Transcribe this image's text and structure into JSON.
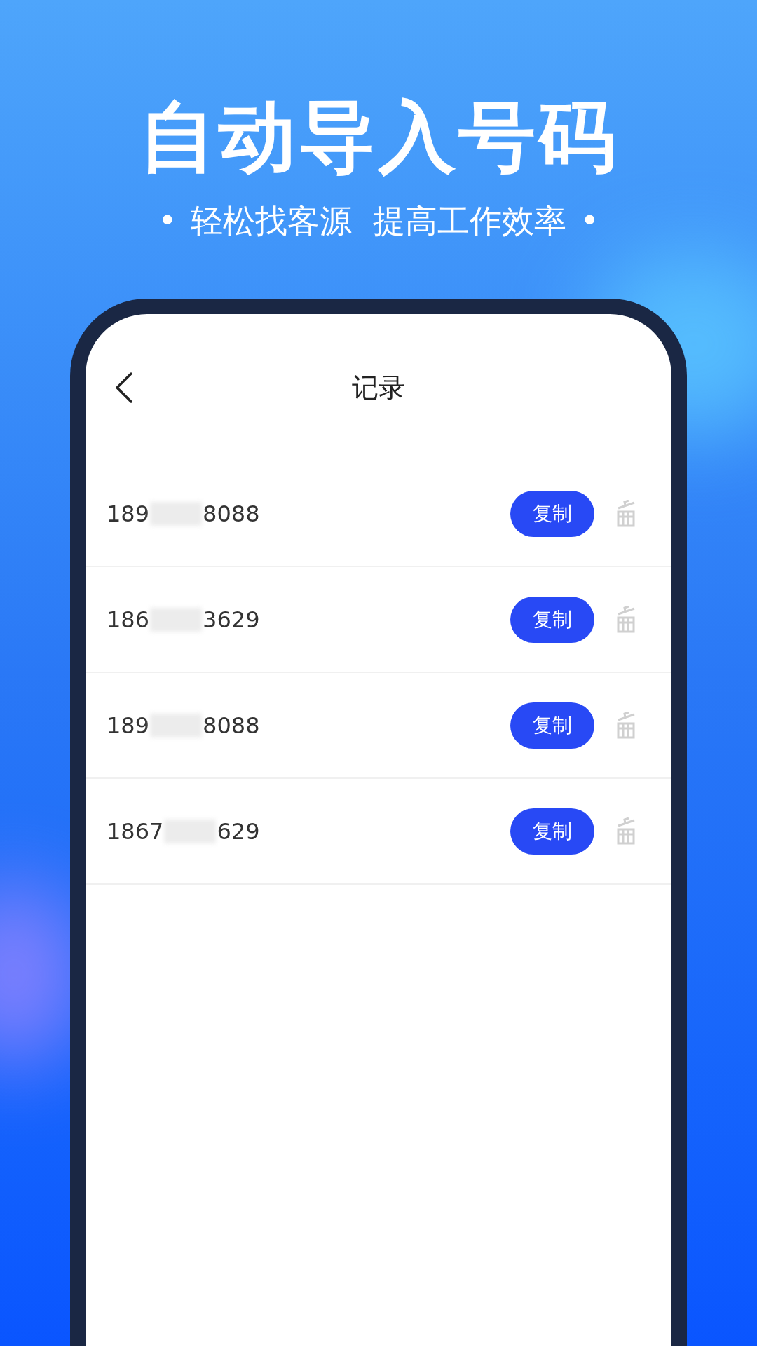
{
  "headline": "自动导入号码",
  "subtitle": {
    "bullet_left": "•",
    "text": "轻松找客源  提高工作效率",
    "bullet_right": "•"
  },
  "phone_screen": {
    "header": {
      "title": "记录"
    },
    "records": [
      {
        "number_start": "189",
        "number_end": "8088",
        "copy_button": "复制"
      },
      {
        "number_start": "186",
        "number_end": "3629",
        "copy_button": "复制"
      },
      {
        "number_start": "189",
        "number_end": "8088",
        "copy_button": "复制"
      },
      {
        "number_start": "1867",
        "number_end": "629",
        "copy_button": "复制"
      }
    ]
  }
}
